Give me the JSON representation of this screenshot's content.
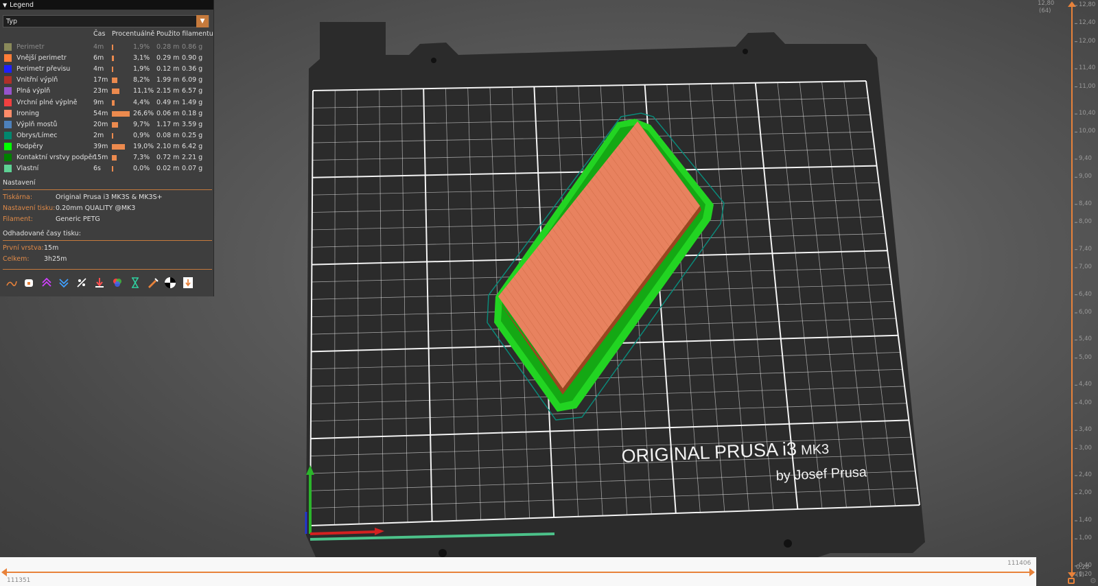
{
  "legend": {
    "title": "Legend",
    "view_type": "Typ",
    "columns": {
      "time": "Čas",
      "percent": "Procentuálně",
      "filament": "Použito filamentu"
    },
    "features": [
      {
        "name": "Perimetr",
        "time": "4m",
        "percent": "1,9%",
        "length": "0.28 m",
        "weight": "0.86 g",
        "color": "#8a8a5a",
        "share": 0.019,
        "dimmed": true
      },
      {
        "name": "Vnější perimetr",
        "time": "6m",
        "percent": "3,1%",
        "length": "0.29 m",
        "weight": "0.90 g",
        "color": "#ff7d38",
        "share": 0.031
      },
      {
        "name": "Perimetr převisu",
        "time": "4m",
        "percent": "1,9%",
        "length": "0.12 m",
        "weight": "0.36 g",
        "color": "#1f1fff",
        "share": 0.019
      },
      {
        "name": "Vnitřní výplň",
        "time": "17m",
        "percent": "8,2%",
        "length": "1.99 m",
        "weight": "6.09 g",
        "color": "#b03029",
        "share": 0.082
      },
      {
        "name": "Plná výplň",
        "time": "23m",
        "percent": "11,1%",
        "length": "2.15 m",
        "weight": "6.57 g",
        "color": "#9654cc",
        "share": 0.111
      },
      {
        "name": "Vrchní plné výplně",
        "time": "9m",
        "percent": "4,4%",
        "length": "0.49 m",
        "weight": "1.49 g",
        "color": "#f04040",
        "share": 0.044
      },
      {
        "name": "Ironing",
        "time": "54m",
        "percent": "26,6%",
        "length": "0.06 m",
        "weight": "0.18 g",
        "color": "#ff8c69",
        "share": 0.266
      },
      {
        "name": "Výplň mostů",
        "time": "20m",
        "percent": "9,7%",
        "length": "1.17 m",
        "weight": "3.59 g",
        "color": "#4d80ba",
        "share": 0.097
      },
      {
        "name": "Obrys/Límec",
        "time": "2m",
        "percent": "0,9%",
        "length": "0.08 m",
        "weight": "0.25 g",
        "color": "#00876e",
        "share": 0.009
      },
      {
        "name": "Podpěry",
        "time": "39m",
        "percent": "19,0%",
        "length": "2.10 m",
        "weight": "6.42 g",
        "color": "#00ff00",
        "share": 0.19
      },
      {
        "name": "Kontaktní vrstvy podpěr",
        "time": "15m",
        "percent": "7,3%",
        "length": "0.72 m",
        "weight": "2.21 g",
        "color": "#008000",
        "share": 0.073
      },
      {
        "name": "Vlastní",
        "time": "6s",
        "percent": "0,0%",
        "length": "0.02 m",
        "weight": "0.07 g",
        "color": "#5ed194",
        "share": 0.0
      }
    ],
    "settings_title": "Nastavení",
    "settings": [
      {
        "key": "Tiskárna:",
        "value": "Original Prusa i3 MK3S & MK3S+"
      },
      {
        "key": "Nastavení tisku:",
        "value": "0.20mm QUALITY @MK3"
      },
      {
        "key": "Filament:",
        "value": "Generic PETG"
      }
    ],
    "estimates_title": "Odhadované časy tisku:",
    "estimates": [
      {
        "key": "První vrstva:",
        "value": "15m"
      },
      {
        "key": "Celkem:",
        "value": "3h25m"
      }
    ],
    "toolbar_icons": [
      "travel-icon",
      "wipe-icon",
      "retractions-icon",
      "deretractions-icon",
      "seams-icon",
      "tool-changes-icon",
      "color-changes-icon",
      "pause-prints-icon",
      "custom-gcodes-icon",
      "center-of-gravity-icon",
      "shells-icon"
    ]
  },
  "bed": {
    "brand_line1": "ORIGINAL PRUSA i3",
    "brand_model": "MK3",
    "brand_line2": "by Josef Prusa"
  },
  "vertical_slider": {
    "top_value": "12,80",
    "top_layer": "(64)",
    "bottom_value": "0,20",
    "bottom_layer": "(1)",
    "ticks_right": [
      "12,80",
      "12,40",
      "12,00",
      "11,40",
      "11,00",
      "10,40",
      "10,00",
      "9,40",
      "9,00",
      "8,40",
      "8,00",
      "7,40",
      "7,00",
      "6,40",
      "6,00",
      "5,40",
      "5,00",
      "4,40",
      "4,00",
      "3,40",
      "3,00",
      "2,40",
      "2,00",
      "1,40",
      "1,00",
      "0,40",
      "0,20"
    ]
  },
  "horizontal_slider": {
    "left_value": "111351",
    "right_value": "111406"
  }
}
